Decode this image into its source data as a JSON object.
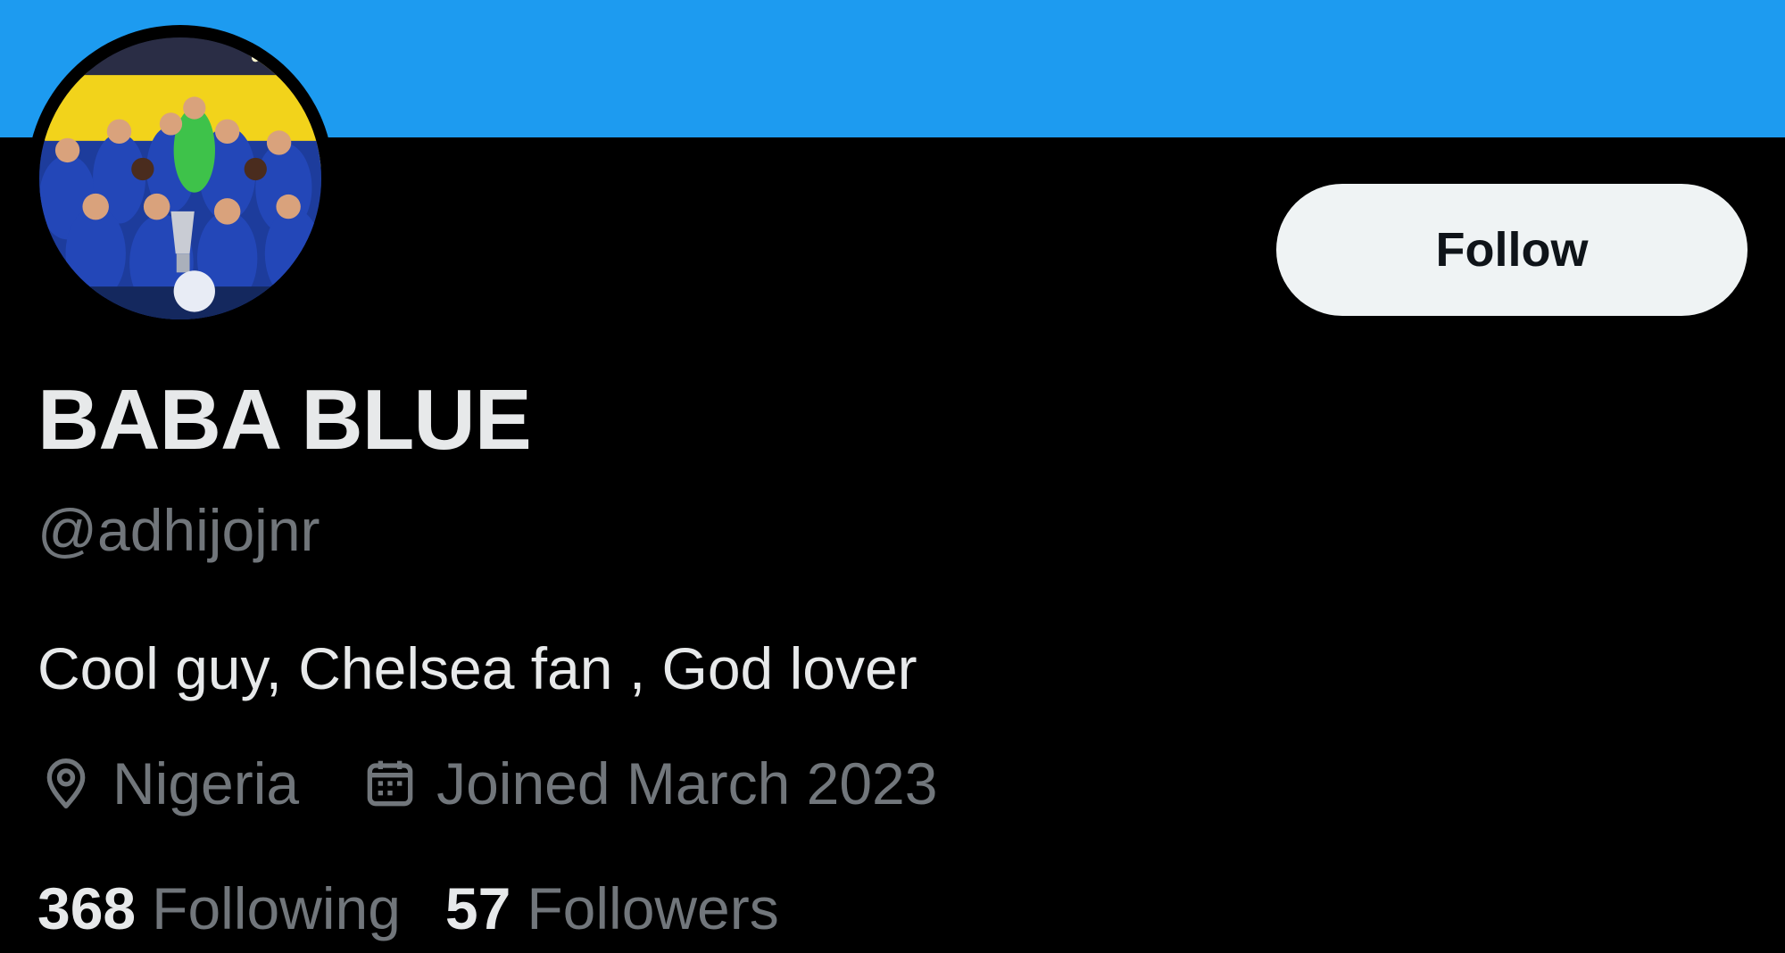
{
  "colors": {
    "banner": "#1d9bf0",
    "background": "#000000",
    "primary_text": "#e7e9ea",
    "secondary_text": "#71767b",
    "follow_button_bg": "#eff3f4"
  },
  "profile": {
    "avatar_icon": "profile-photo",
    "display_name": "BABA BLUE",
    "handle": "@adhijojnr",
    "bio": "Cool guy, Chelsea fan , God lover",
    "location_icon": "location-pin-icon",
    "location": "Nigeria",
    "joined_icon": "calendar-icon",
    "joined": "Joined March 2023"
  },
  "actions": {
    "follow_label": "Follow"
  },
  "stats": {
    "following_count": "368",
    "following_label": "Following",
    "followers_count": "57",
    "followers_label": "Followers"
  }
}
